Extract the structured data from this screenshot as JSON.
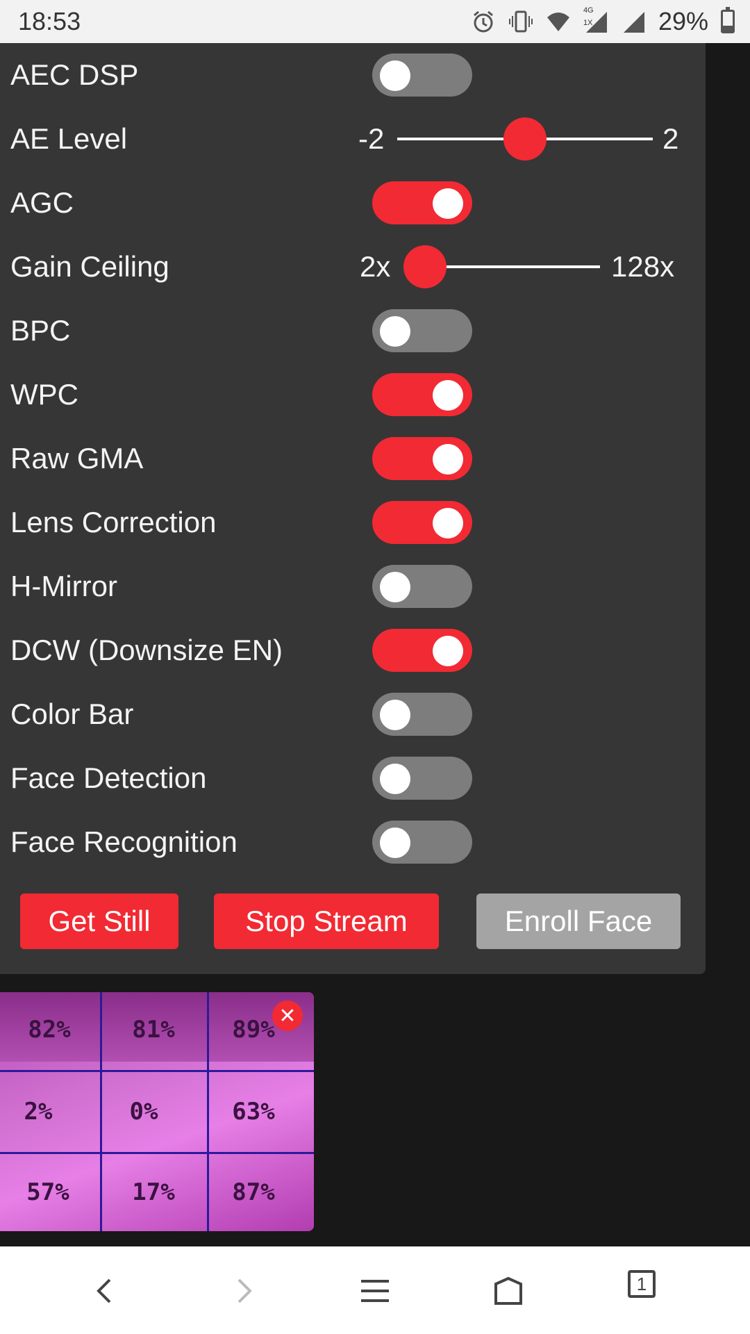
{
  "status_bar": {
    "time": "18:53",
    "battery_percent": "29%",
    "battery_level": 0.29,
    "icons": [
      "alarm-icon",
      "vibrate-icon",
      "wifi-icon",
      "signal-4g-icon",
      "signal-icon",
      "battery-icon"
    ],
    "network_label_top": "4G",
    "network_label_bottom": "1X"
  },
  "settings": {
    "aec_dsp": {
      "label": "AEC DSP",
      "on": false
    },
    "ae_level": {
      "label": "AE Level",
      "min": "-2",
      "max": "2",
      "value": 0.5
    },
    "agc": {
      "label": "AGC",
      "on": true
    },
    "gain_ceiling": {
      "label": "Gain Ceiling",
      "min": "2x",
      "max": "128x",
      "value": 0
    },
    "bpc": {
      "label": "BPC",
      "on": false
    },
    "wpc": {
      "label": "WPC",
      "on": true
    },
    "raw_gma": {
      "label": "Raw GMA",
      "on": true
    },
    "lens_correction": {
      "label": "Lens Correction",
      "on": true
    },
    "h_mirror": {
      "label": "H-Mirror",
      "on": false
    },
    "dcw": {
      "label": "DCW (Downsize EN)",
      "on": true
    },
    "color_bar": {
      "label": "Color Bar",
      "on": false
    },
    "face_detection": {
      "label": "Face Detection",
      "on": false
    },
    "face_recognition": {
      "label": "Face Recognition",
      "on": false
    }
  },
  "buttons": {
    "get_still": "Get Still",
    "stop_stream": "Stop Stream",
    "enroll_face": "Enroll Face"
  },
  "preview": {
    "close_symbol": "✕",
    "cells": [
      [
        "82%",
        "81%",
        "89%"
      ],
      [
        "2%",
        "0%",
        "63%"
      ],
      [
        "57%",
        "17%",
        "87%"
      ]
    ]
  },
  "colors": {
    "accent": "#f22a33",
    "panel": "#363636",
    "toggle_off": "#7d7d7d",
    "button_disabled": "#a4a4a4"
  },
  "nav": {
    "tabs_count": "1",
    "icons": [
      "back-icon",
      "forward-icon",
      "menu-icon",
      "home-icon",
      "tabs-icon"
    ]
  }
}
